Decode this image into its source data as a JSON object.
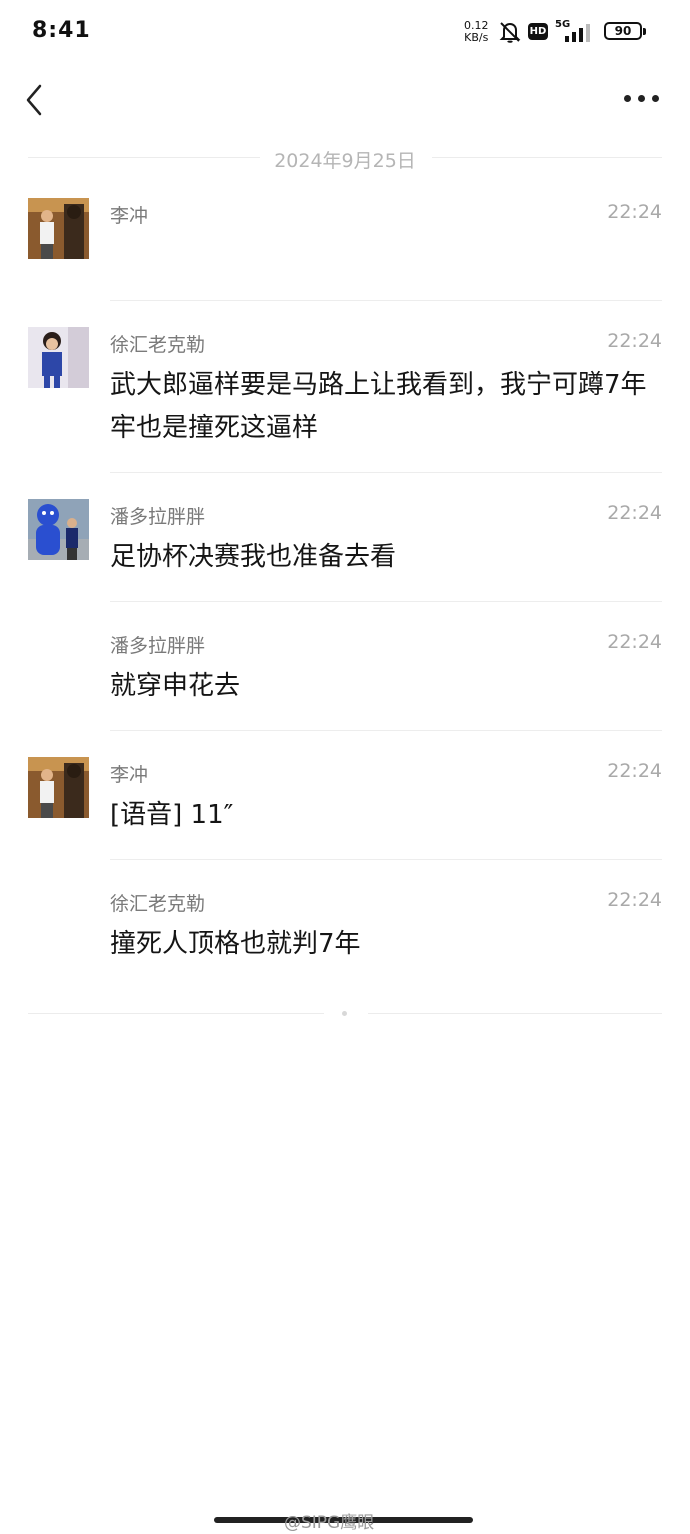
{
  "status_bar": {
    "time": "8:41",
    "net_speed_value": "0.12",
    "net_speed_unit": "KB/s",
    "hd_label": "HD",
    "signal_label": "5G",
    "battery": "90"
  },
  "header": {
    "back_icon": "chevron-left-icon",
    "more_icon": "more-horizontal-icon"
  },
  "date_divider": "2024年9月25日",
  "messages": [
    {
      "sender": "李冲",
      "time": "22:24",
      "text": ""
    },
    {
      "sender": "徐汇老克勒",
      "time": "22:24",
      "text": "武大郎逼样要是马路上让我看到，我宁可蹲7年牢也是撞死这逼样"
    },
    {
      "sender": "潘多拉胖胖",
      "time": "22:24",
      "text": "足协杯决赛我也准备去看"
    },
    {
      "sender": "潘多拉胖胖",
      "time": "22:24",
      "text": "就穿申花去"
    },
    {
      "sender": "李冲",
      "time": "22:24",
      "text": "[语音] 11″"
    },
    {
      "sender": "徐汇老克勒",
      "time": "22:24",
      "text": "撞死人顶格也就判7年"
    }
  ],
  "watermark": "@SIPG鹰眼",
  "colors": {
    "background": "#ffffff",
    "name": "#7a7a7a",
    "time": "#a9a9a9",
    "text": "#151515"
  }
}
